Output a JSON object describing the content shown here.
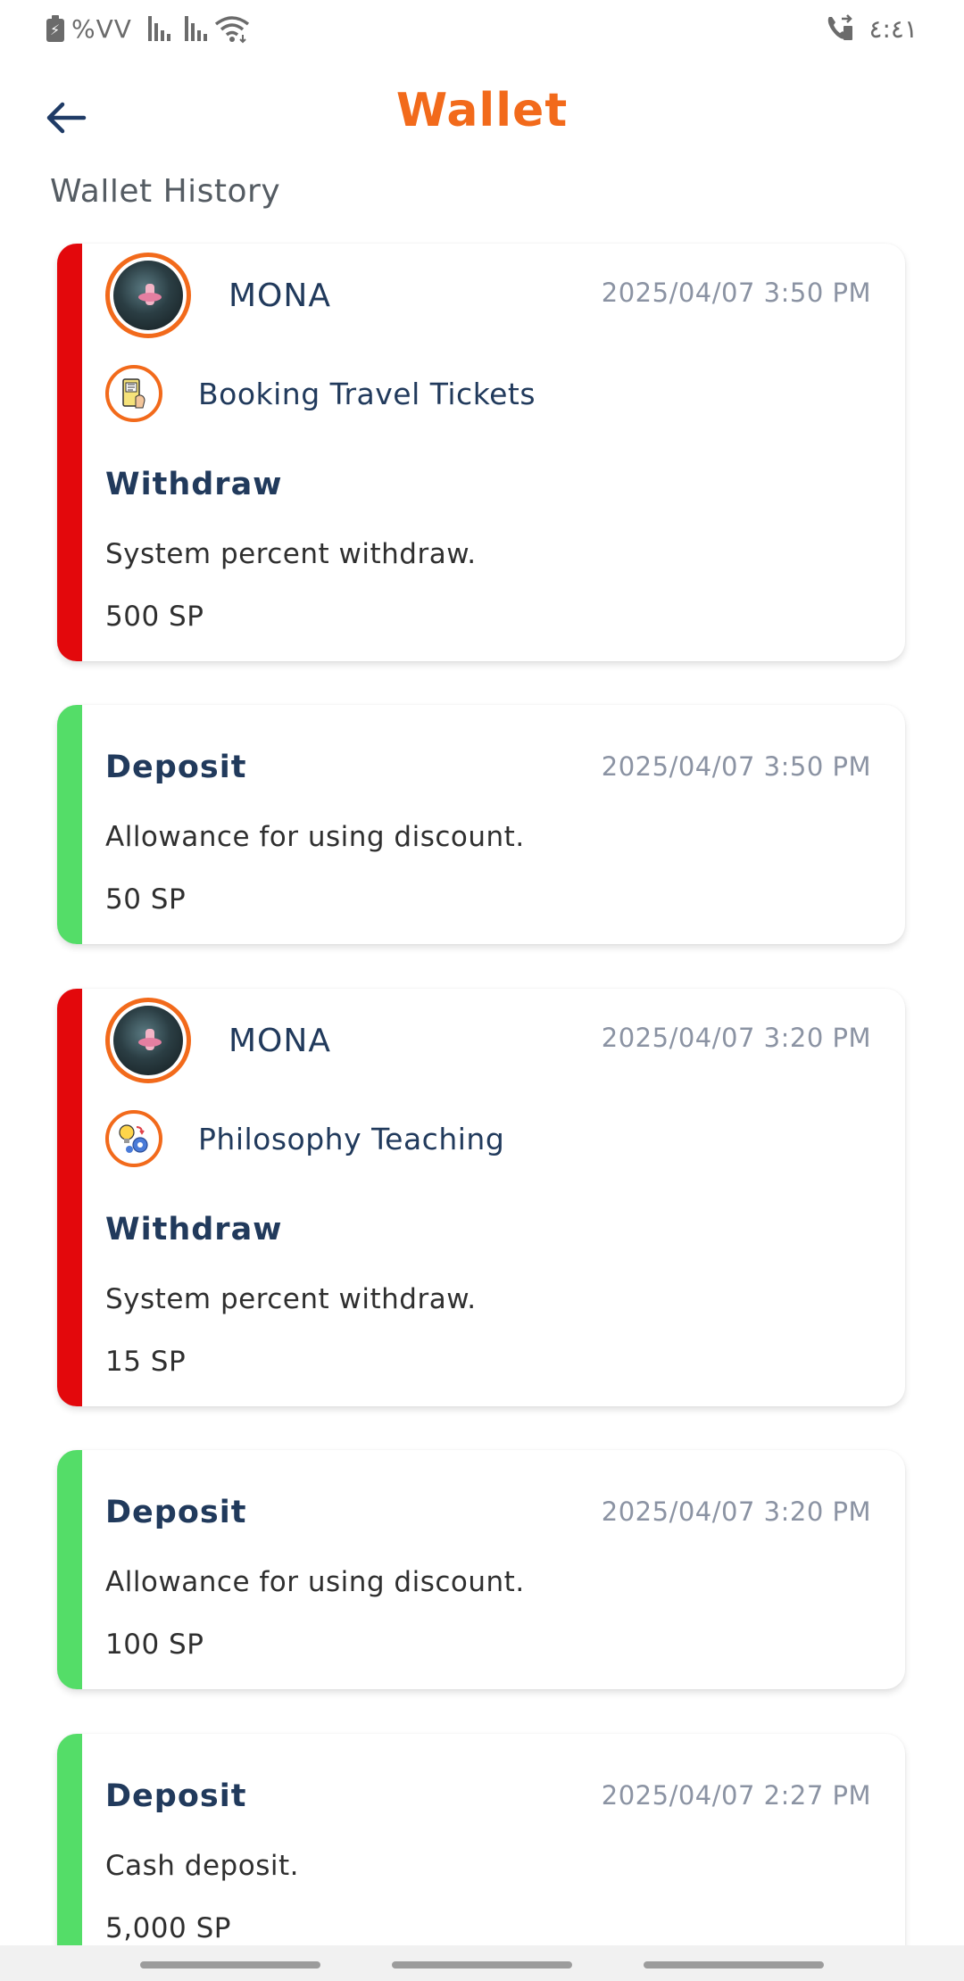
{
  "status_bar": {
    "battery": "%VV",
    "time": "٤:٤١",
    "icons": [
      "battery-charging-icon",
      "signal-icon",
      "signal-icon",
      "wifi-icon",
      "call-forward-icon"
    ]
  },
  "app_bar": {
    "title": "Wallet",
    "back_icon": "arrow-left-icon",
    "title_color": "#f26a1b"
  },
  "section": {
    "title": "Wallet History"
  },
  "colors": {
    "withdraw_accent": "#e3080c",
    "deposit_accent": "#54dd68",
    "text_dark_blue": "#213a5c",
    "date_gray": "#8b93a3"
  },
  "transactions": [
    {
      "type": "Withdraw",
      "user": "MONA",
      "service": "Booking Travel Tickets",
      "service_icon": "ticket-icon",
      "date": "2025/04/07 3:50 PM",
      "description": "System percent withdraw.",
      "amount": "500 SP"
    },
    {
      "type": "Deposit",
      "date": "2025/04/07 3:50 PM",
      "description": "Allowance for using discount.",
      "amount": "50 SP"
    },
    {
      "type": "Withdraw",
      "user": "MONA",
      "service": "Philosophy Teaching",
      "service_icon": "idea-gears-icon",
      "date": "2025/04/07 3:20 PM",
      "description": "System percent withdraw.",
      "amount": "15 SP"
    },
    {
      "type": "Deposit",
      "date": "2025/04/07 3:20 PM",
      "description": "Allowance for using discount.",
      "amount": "100 SP"
    },
    {
      "type": "Deposit",
      "date": "2025/04/07 2:27 PM",
      "description": "Cash deposit.",
      "amount": "5,000 SP"
    }
  ]
}
